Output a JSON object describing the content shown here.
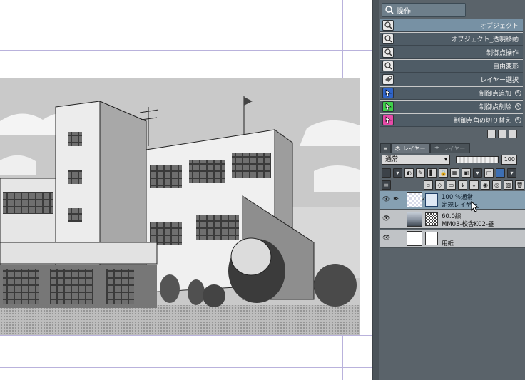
{
  "tool_panel": {
    "header_label": "操作",
    "items": [
      {
        "label": "オブジェクト",
        "selected": true
      },
      {
        "label": "オブジェクト_透明移動",
        "selected": false
      },
      {
        "label": "制御点操作",
        "selected": false
      },
      {
        "label": "自由変形",
        "selected": false
      },
      {
        "label": "レイヤー選択",
        "selected": false
      },
      {
        "label": "制御点追加",
        "selected": false
      },
      {
        "label": "制御点削除",
        "selected": false
      },
      {
        "label": "制御点角の切り替え",
        "selected": false
      }
    ]
  },
  "layer_panel": {
    "tabs": [
      {
        "label": "レイヤー",
        "active": true
      },
      {
        "label": "レイヤー",
        "active": false
      }
    ],
    "blend_mode": "通常",
    "opacity": "100",
    "layers": [
      {
        "line1": "100 %通常",
        "line2": "定規レイヤー",
        "selected": true
      },
      {
        "line1": "60.0線",
        "line2": "MM03-校舎K02-昼",
        "selected": false
      },
      {
        "line1": "",
        "line2": "用紙",
        "selected": false
      }
    ]
  },
  "colors": {
    "panel_bg": "#5a636a",
    "selected_tool": "#7791a4",
    "selected_layer": "#86a0b2",
    "guide": "#b9b2dc"
  }
}
